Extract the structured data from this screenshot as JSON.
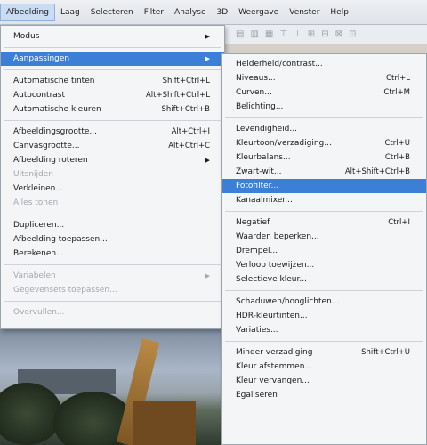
{
  "menubar": {
    "items": [
      "Afbeelding",
      "Laag",
      "Selecteren",
      "Filter",
      "Analyse",
      "3D",
      "Weergave",
      "Venster",
      "Help"
    ]
  },
  "main_menu": [
    {
      "label": "Modus",
      "submenu": true
    },
    {
      "sep": true
    },
    {
      "label": "Aanpassingen",
      "submenu": true,
      "highlight": true
    },
    {
      "sep": true
    },
    {
      "label": "Automatische tinten",
      "shortcut": "Shift+Ctrl+L"
    },
    {
      "label": "Autocontrast",
      "shortcut": "Alt+Shift+Ctrl+L"
    },
    {
      "label": "Automatische kleuren",
      "shortcut": "Shift+Ctrl+B"
    },
    {
      "sep": true
    },
    {
      "label": "Afbeeldingsgrootte...",
      "shortcut": "Alt+Ctrl+I"
    },
    {
      "label": "Canvasgrootte...",
      "shortcut": "Alt+Ctrl+C"
    },
    {
      "label": "Afbeelding roteren",
      "submenu": true
    },
    {
      "label": "Uitsnijden",
      "disabled": true
    },
    {
      "label": "Verkleinen..."
    },
    {
      "label": "Alles tonen",
      "disabled": true
    },
    {
      "sep": true
    },
    {
      "label": "Dupliceren..."
    },
    {
      "label": "Afbeelding toepassen..."
    },
    {
      "label": "Berekenen..."
    },
    {
      "sep": true
    },
    {
      "label": "Variabelen",
      "disabled": true,
      "submenu": true
    },
    {
      "label": "Gegevensets toepassen...",
      "disabled": true
    },
    {
      "sep": true
    },
    {
      "label": "Overvullen...",
      "disabled": true
    }
  ],
  "sub_menu": [
    {
      "label": "Helderheid/contrast..."
    },
    {
      "label": "Niveaus...",
      "shortcut": "Ctrl+L"
    },
    {
      "label": "Curven...",
      "shortcut": "Ctrl+M"
    },
    {
      "label": "Belichting..."
    },
    {
      "sep": true
    },
    {
      "label": "Levendigheid..."
    },
    {
      "label": "Kleurtoon/verzadiging...",
      "shortcut": "Ctrl+U"
    },
    {
      "label": "Kleurbalans...",
      "shortcut": "Ctrl+B"
    },
    {
      "label": "Zwart-wit...",
      "shortcut": "Alt+Shift+Ctrl+B"
    },
    {
      "label": "Fotofilter...",
      "highlight": true
    },
    {
      "label": "Kanaalmixer..."
    },
    {
      "sep": true
    },
    {
      "label": "Negatief",
      "shortcut": "Ctrl+I"
    },
    {
      "label": "Waarden beperken..."
    },
    {
      "label": "Drempel..."
    },
    {
      "label": "Verloop toewijzen..."
    },
    {
      "label": "Selectieve kleur..."
    },
    {
      "sep": true
    },
    {
      "label": "Schaduwen/hooglichten..."
    },
    {
      "label": "HDR-kleurtinten..."
    },
    {
      "label": "Variaties..."
    },
    {
      "sep": true
    },
    {
      "label": "Minder verzadiging",
      "shortcut": "Shift+Ctrl+U"
    },
    {
      "label": "Kleur afstemmen..."
    },
    {
      "label": "Kleur vervangen..."
    },
    {
      "label": "Egaliseren"
    }
  ],
  "colors": {
    "highlight": "#3b7fd6",
    "menu_bg": "#f4f5f7",
    "disabled_text": "#a3a7ad"
  }
}
